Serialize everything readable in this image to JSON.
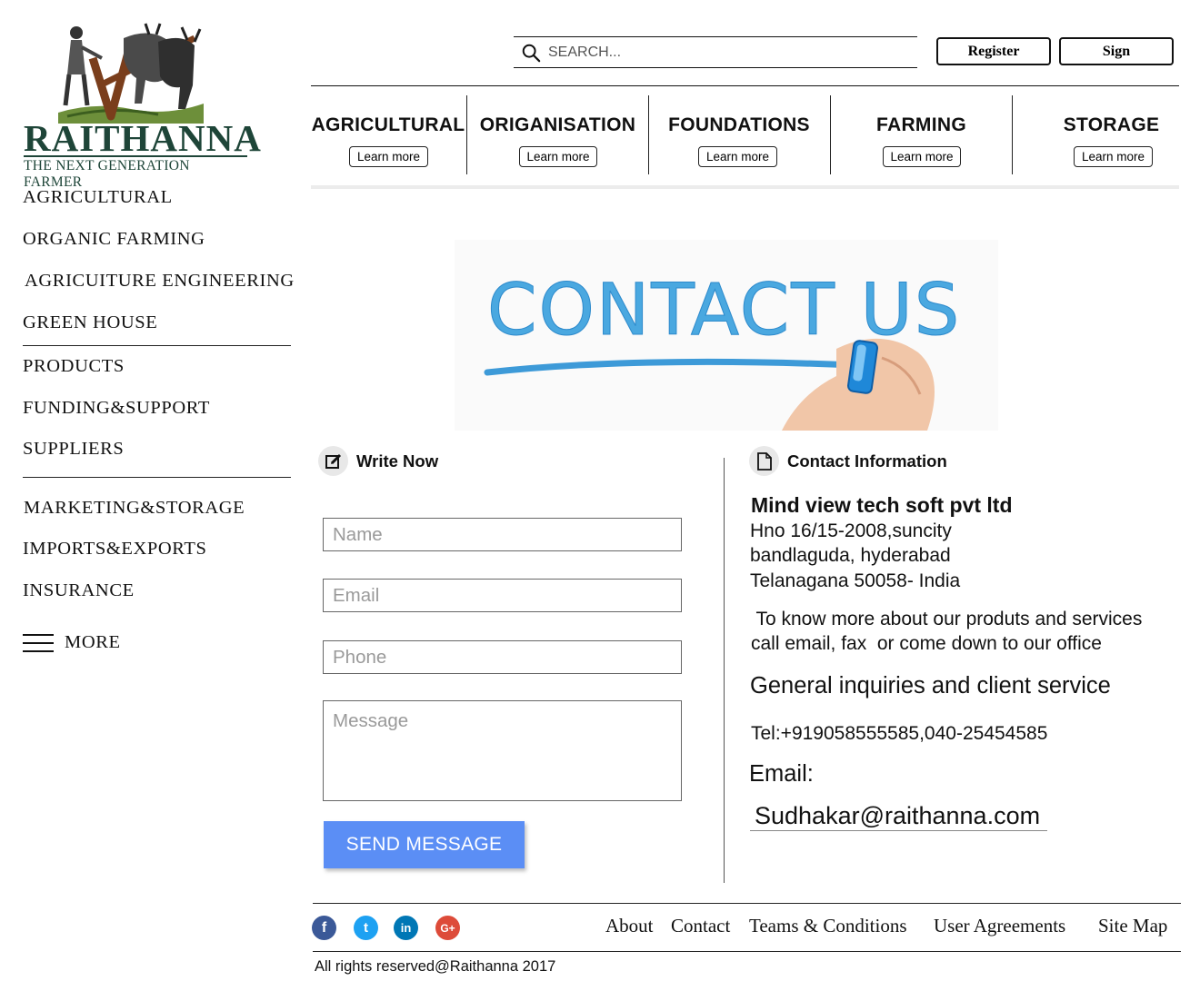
{
  "brand": {
    "name": "RAITHANNA",
    "tagline": "THE NEXT GENERATION FARMER",
    "color": "#1e4538"
  },
  "sidebar": {
    "items": [
      {
        "label": "AGRICULTURAL"
      },
      {
        "label": "ORGANIC FARMING"
      },
      {
        "label": "AGRICUITURE ENGINEERING"
      },
      {
        "label": "GREEN HOUSE"
      },
      {
        "label": "PRODUCTS"
      },
      {
        "label": "FUNDING&SUPPORT"
      },
      {
        "label": "SUPPLIERS"
      },
      {
        "label": "MARKETING&STORAGE"
      },
      {
        "label": "IMPORTS&EXPORTS"
      },
      {
        "label": "INSURANCE"
      }
    ],
    "more_label": "MORE"
  },
  "header": {
    "search_placeholder": "SEARCH...",
    "register_label": "Register",
    "sign_label": "Sign"
  },
  "categories": [
    {
      "title": "AGRICULTURAL",
      "button": "Learn more"
    },
    {
      "title": "ORIGANISATION",
      "button": "Learn more"
    },
    {
      "title": "FOUNDATIONS",
      "button": "Learn more"
    },
    {
      "title": "FARMING",
      "button": "Learn more"
    },
    {
      "title": "STORAGE",
      "button": "Learn more"
    }
  ],
  "hero": {
    "text": "CONTACT US",
    "color": "#4aa8e0"
  },
  "form": {
    "heading": "Write Now",
    "name_placeholder": "Name",
    "email_placeholder": "Email",
    "phone_placeholder": "Phone",
    "message_placeholder": "Message",
    "submit_label": "SEND MESSAGE",
    "submit_color": "#5b8ef5"
  },
  "contact": {
    "heading": "Contact Information",
    "company": "Mind view tech soft pvt ltd",
    "address_line1": "Hno 16/15-2008,suncity",
    "address_line2": "bandlaguda, hyderabad",
    "address_line3": "Telanagana 50058- India",
    "about_line1": " To know more about our produts and services",
    "about_line2": "call email, fax  or come down to our office",
    "general_heading": "General inquiries and client service",
    "tel": "Tel:+919058555585,040-25454585",
    "email_label": "Email:",
    "email_value": "Sudhakar@raithanna.com"
  },
  "footer": {
    "social": [
      {
        "icon": "facebook-icon",
        "glyph": "f",
        "color": "#3b5998"
      },
      {
        "icon": "twitter-icon",
        "glyph": "t",
        "color": "#1da1f2"
      },
      {
        "icon": "linkedin-icon",
        "glyph": "in",
        "color": "#0077b5"
      },
      {
        "icon": "google-plus-icon",
        "glyph": "G+",
        "color": "#dd4b39"
      }
    ],
    "links": [
      {
        "label": "About"
      },
      {
        "label": "Contact"
      },
      {
        "label": "Teams & Conditions"
      },
      {
        "label": "User Agreements"
      },
      {
        "label": "Site Map"
      }
    ],
    "copyright": "All rights reserved@Raithanna 2017"
  }
}
